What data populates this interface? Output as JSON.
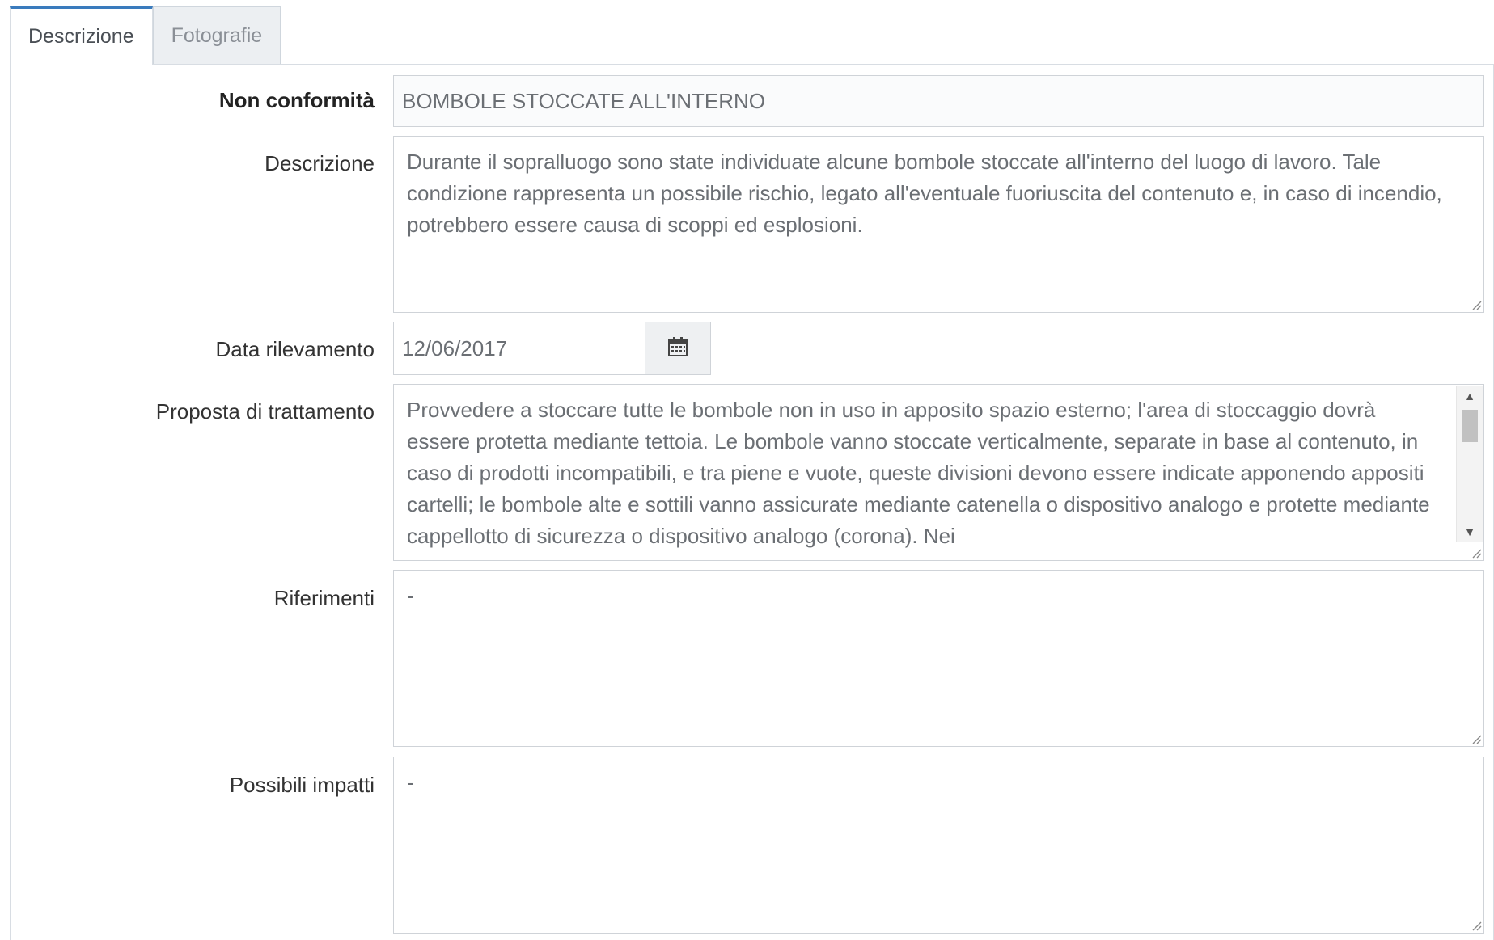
{
  "tabs": [
    {
      "label": "Descrizione",
      "active": true
    },
    {
      "label": "Fotografie",
      "active": false
    }
  ],
  "form": {
    "non_conformita": {
      "label": "Non conformità",
      "value": "BOMBOLE STOCCATE ALL'INTERNO"
    },
    "descrizione": {
      "label": "Descrizione",
      "value": "Durante il sopralluogo sono state individuate alcune bombole stoccate all'interno del luogo di lavoro. Tale condizione rappresenta un possibile rischio, legato all'eventuale fuoriuscita del contenuto e, in caso di incendio, potrebbero essere causa di scoppi ed esplosioni."
    },
    "data_rilevamento": {
      "label": "Data rilevamento",
      "value": "12/06/2017",
      "icon": "calendar-icon"
    },
    "proposta": {
      "label": "Proposta di trattamento",
      "value": "Provvedere a stoccare tutte le bombole non in uso in apposito spazio esterno; l'area di stoccaggio dovrà essere protetta mediante tettoia. Le bombole vanno stoccate verticalmente, separate in base al contenuto, in caso di prodotti incompatibili, e tra piene e vuote, queste divisioni devono essere indicate apponendo appositi cartelli; le bombole alte e sottili vanno assicurate mediante catenella o dispositivo analogo e protette mediante cappellotto di sicurezza o dispositivo analogo (corona). Nei"
    },
    "riferimenti": {
      "label": "Riferimenti",
      "value": "-"
    },
    "impatti": {
      "label": "Possibili impatti",
      "value": "-"
    }
  },
  "colors": {
    "tab_active_border": "#3a7bbd",
    "field_border": "#cfd3d8",
    "label_text": "#333333",
    "field_text": "#6b6f74"
  }
}
